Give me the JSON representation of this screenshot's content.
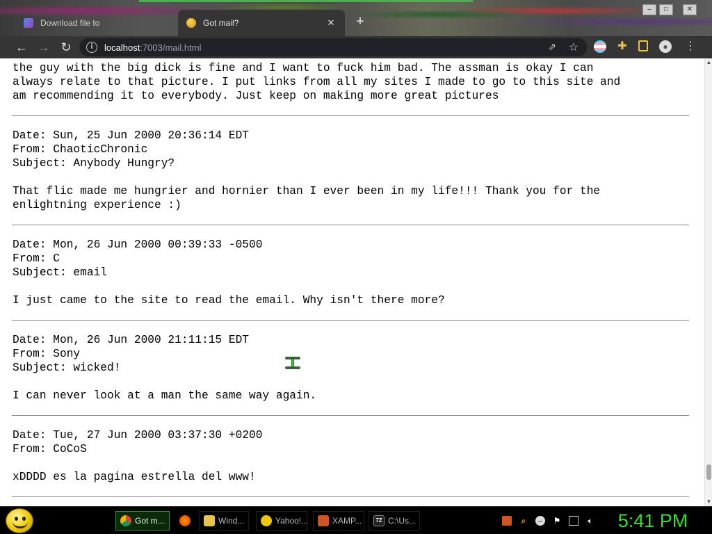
{
  "browser": {
    "tabs": [
      {
        "title": "Download file to",
        "active": false
      },
      {
        "title": "Got mail?",
        "active": true
      }
    ],
    "new_tab_glyph": "+",
    "url_host": "localhost",
    "url_rest": ":7003/mail.html"
  },
  "mail": {
    "partial_top": [
      "the guy with the big dick is fine and I want to fuck him bad. The assman is okay I can",
      "always relate to that picture. I put links from all my sites I made to go to this site and",
      "am recommending it to everybody. Just keep on making more great pictures"
    ],
    "messages": [
      {
        "date": "Date: Sun, 25 Jun 2000 20:36:14 EDT",
        "from": "From: ChaoticChronic",
        "subject": "Subject: Anybody Hungry?",
        "body": [
          "That flic made me hungrier and hornier than I ever been in my life!!! Thank you for the",
          "enlightning experience :)"
        ]
      },
      {
        "date": "Date: Mon, 26 Jun 2000 00:39:33 -0500",
        "from": "From: C",
        "subject": "Subject: email",
        "body": [
          "I just came to the site to read the email. Why isn't there more?"
        ]
      },
      {
        "date": "Date: Mon, 26 Jun 2000 21:11:15 EDT",
        "from": "From: Sony",
        "subject": "Subject: wicked!",
        "body": [
          "I can never look at a man the same way again."
        ]
      },
      {
        "date": "Date: Tue, 27 Jun 2000 03:37:30 +0200",
        "from": "From: CoCoS",
        "body": [
          "xDDDD es la pagina estrella del www!"
        ]
      }
    ]
  },
  "taskbar": {
    "items": [
      {
        "label": "Got m..."
      },
      {
        "label": "Wind..."
      },
      {
        "label": "Yahoo!..."
      },
      {
        "label": "XAMP..."
      },
      {
        "label": "C:\\Us..."
      }
    ],
    "cmd_icon_text": "7Z",
    "clock": "5:41 PM"
  },
  "colors": {
    "clock": "#30e030",
    "page_bg": "#ffffff",
    "toolbar_bg": "#353535"
  },
  "icons": {
    "back": "arrow-left-icon",
    "forward": "arrow-right-icon",
    "reload": "reload-icon",
    "share": "share-icon",
    "bookmark": "star-icon"
  }
}
